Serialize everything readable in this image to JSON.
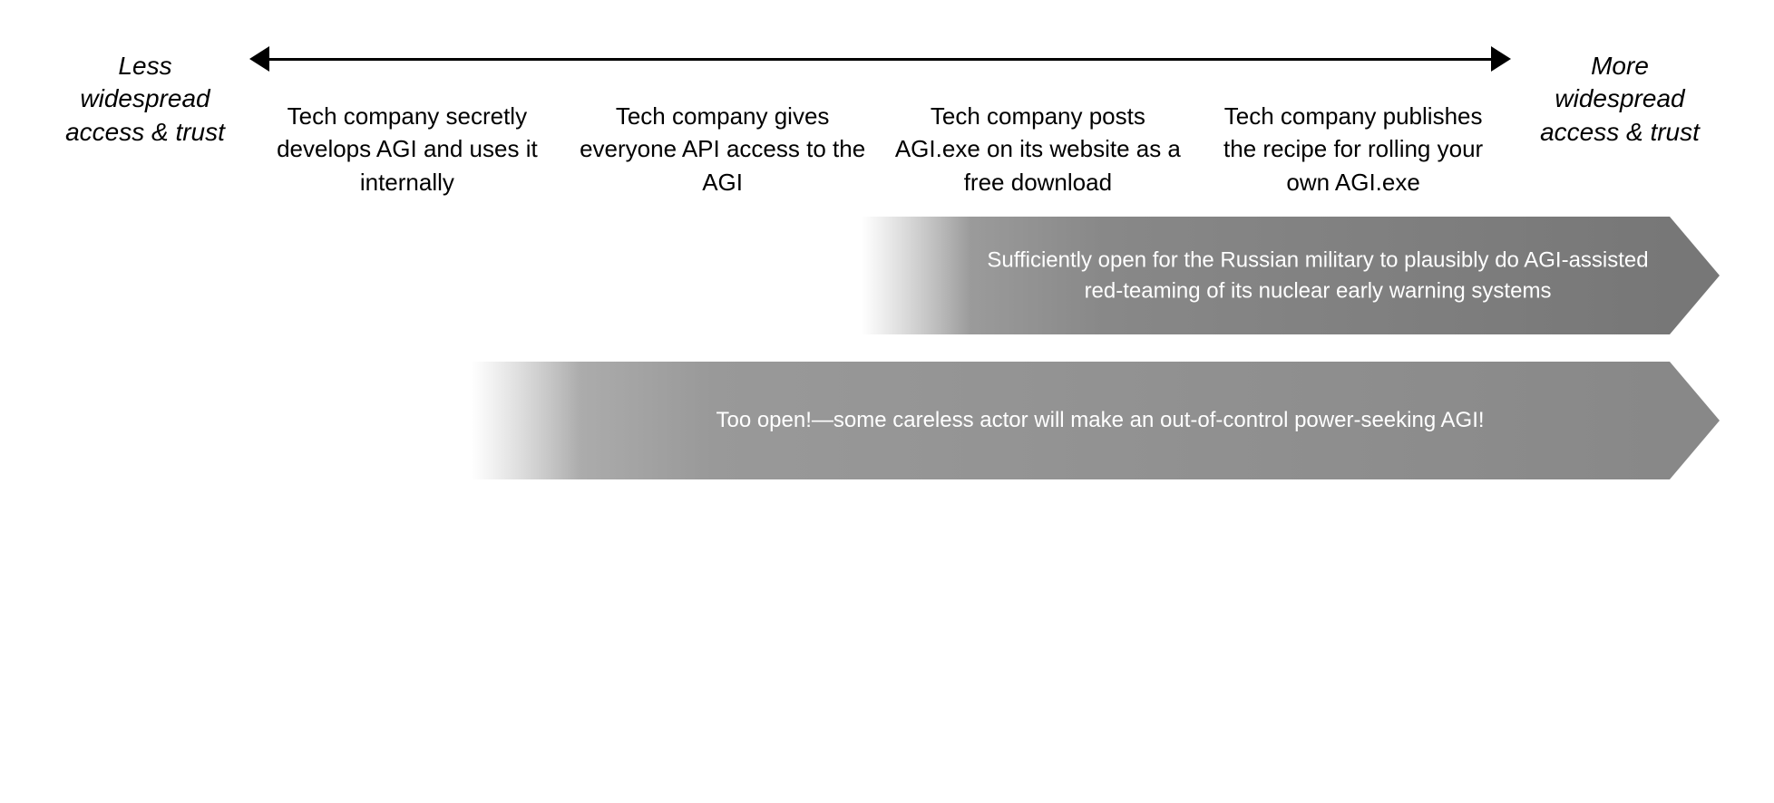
{
  "labels": {
    "less": "Less\nwidespread\naccess & trust",
    "less_line1": "Less",
    "less_line2": "widespread",
    "less_line3": "access & trust",
    "more_line1": "More",
    "more_line2": "widespread",
    "more_line3": "access & trust"
  },
  "columns": [
    {
      "text": "Tech company secretly develops AGI and uses it internally"
    },
    {
      "text": "Tech company gives everyone API access to the AGI"
    },
    {
      "text": "Tech company posts AGI.exe on its website as a free download"
    },
    {
      "text": "Tech company publishes the recipe for rolling your own AGI.exe"
    }
  ],
  "arrows": {
    "upper": {
      "text": "Sufficiently open for the Russian military to plausibly do AGI-assisted red-teaming of its nuclear early warning systems"
    },
    "lower": {
      "text": "Too open!—some careless actor will make an out-of-control power-seeking AGI!"
    }
  }
}
